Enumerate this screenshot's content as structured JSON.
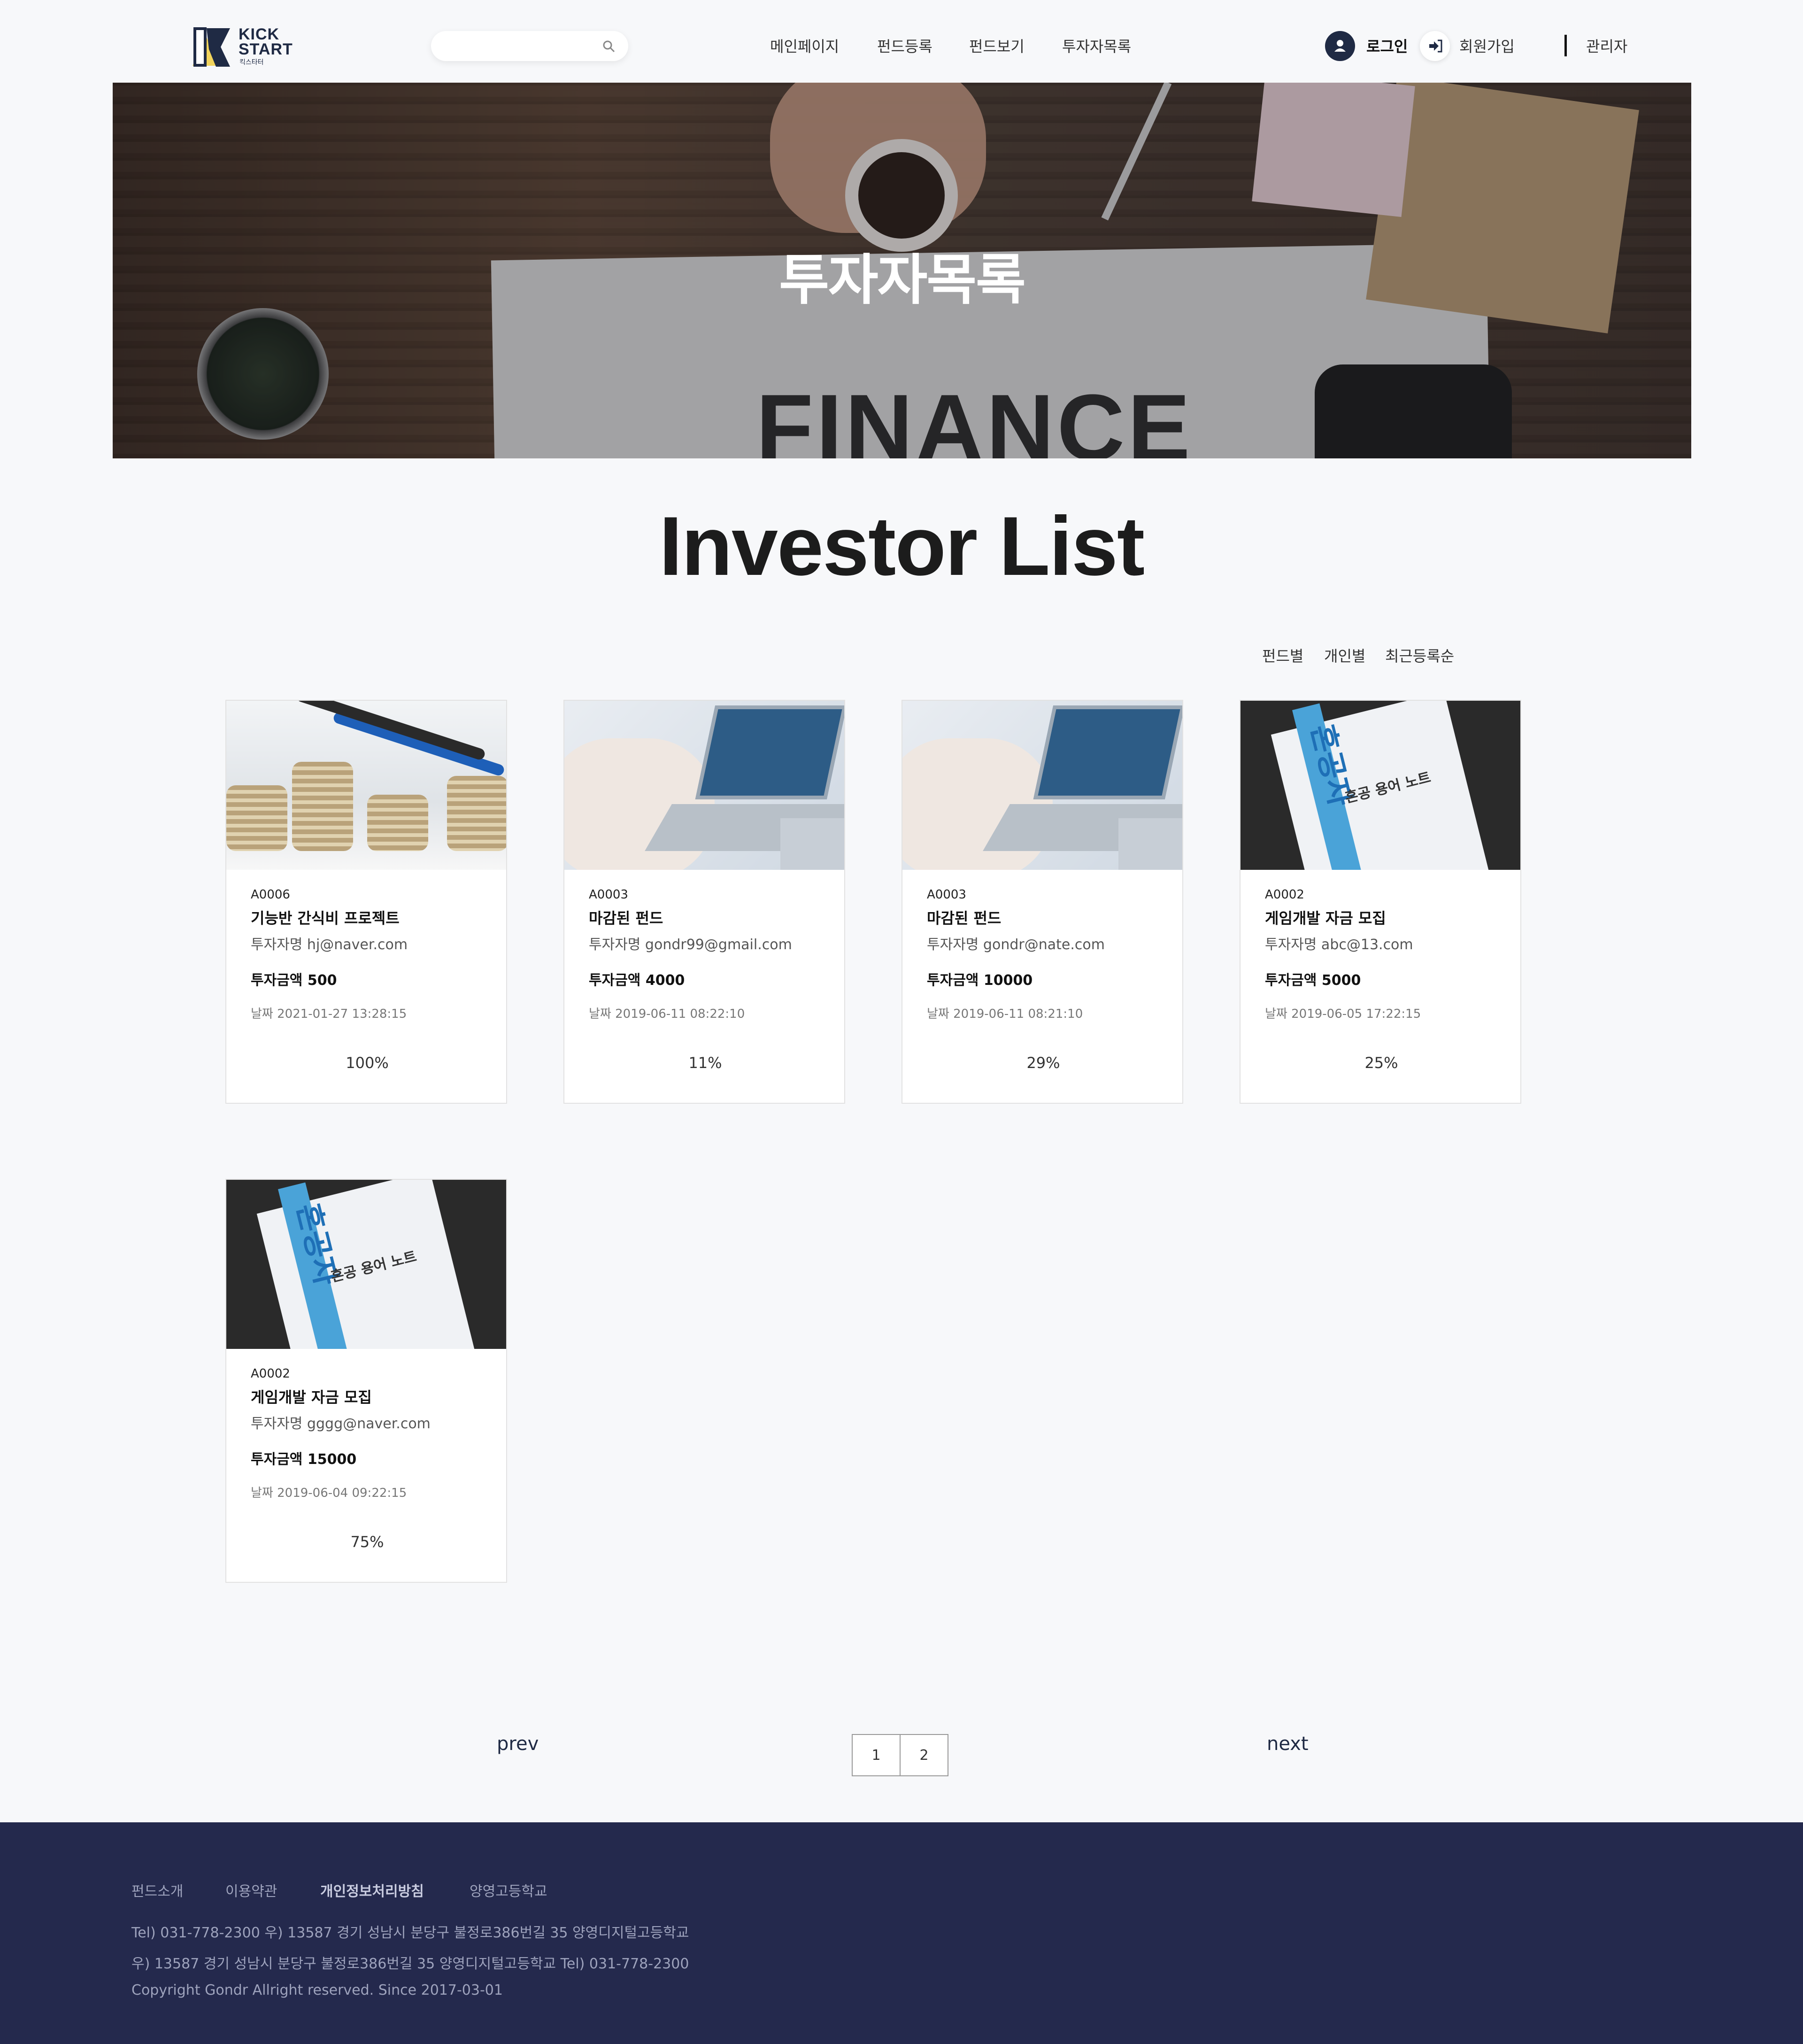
{
  "header": {
    "logo": {
      "line1": "KICK",
      "line2": "START",
      "sub": "킥스타터"
    },
    "search": {
      "value": "",
      "placeholder": ""
    },
    "nav": [
      "메인페이지",
      "펀드등록",
      "펀드보기",
      "투자자목록"
    ],
    "login": "로그인",
    "signup": "회원가입",
    "admin": "관리자"
  },
  "hero": {
    "title": "투자자목록",
    "image_text": "FINANCE"
  },
  "main": {
    "title": "Investor List",
    "sort": [
      "펀드별",
      "개인별",
      "최근등록순"
    ]
  },
  "cards": [
    {
      "image": "coins",
      "code": "A0006",
      "title": "기능반 간식비 프로젝트",
      "investor": "투자자명 hj@naver.com",
      "amount": "투자금액 500",
      "date": "날짜 2021-01-27 13:28:15",
      "percent": "100%",
      "progress": 1.0
    },
    {
      "image": "laptop",
      "code": "A0003",
      "title": "마감된 펀드",
      "investor": "투자자명 gondr99@gmail.com",
      "amount": "투자금액 4000",
      "date": "날짜 2019-06-11 08:22:10",
      "percent": "11%",
      "progress": 0.11
    },
    {
      "image": "laptop",
      "code": "A0003",
      "title": "마감된 펀드",
      "investor": "투자자명 gondr@nate.com",
      "amount": "투자금액 10000",
      "date": "날짜 2019-06-11 08:21:10",
      "percent": "29%",
      "progress": 0.29
    },
    {
      "image": "book",
      "code": "A0002",
      "title": "게임개발 자금 모집",
      "investor": "투자자명 abc@13.com",
      "amount": "투자금액 5000",
      "date": "날짜 2019-06-05 17:22:15",
      "percent": "25%",
      "progress": 0.25
    },
    {
      "image": "book",
      "code": "A0002",
      "title": "게임개발 자금 모집",
      "investor": "투자자명 gggg@naver.com",
      "amount": "투자금액 15000",
      "date": "날짜 2019-06-04 09:22:15",
      "percent": "75%",
      "progress": 0.75
    }
  ],
  "book_art": {
    "big": "혼공자",
    "small": "혼공 용어 노트"
  },
  "pagination": {
    "prev": "prev",
    "next": "next",
    "pages": [
      "1",
      "2"
    ]
  },
  "footer": {
    "links": [
      "펀드소개",
      "이용약관",
      "개인정보처리방침",
      "양영고등학교"
    ],
    "line1": "Tel) 031-778-2300     우) 13587 경기 성남시 분당구 불정로386번길 35 양영디지털고등학교",
    "line2": "우) 13587 경기 성남시 분당구 불정로386번길 35 양영디지털고등학교     Tel) 031-778-2300",
    "copyright": "Copyright Gondr Allright reserved. Since 2017-03-01"
  },
  "colors": {
    "navy": "#24294d",
    "brand": "#1f2a44",
    "accent": "#4aa3d8"
  }
}
